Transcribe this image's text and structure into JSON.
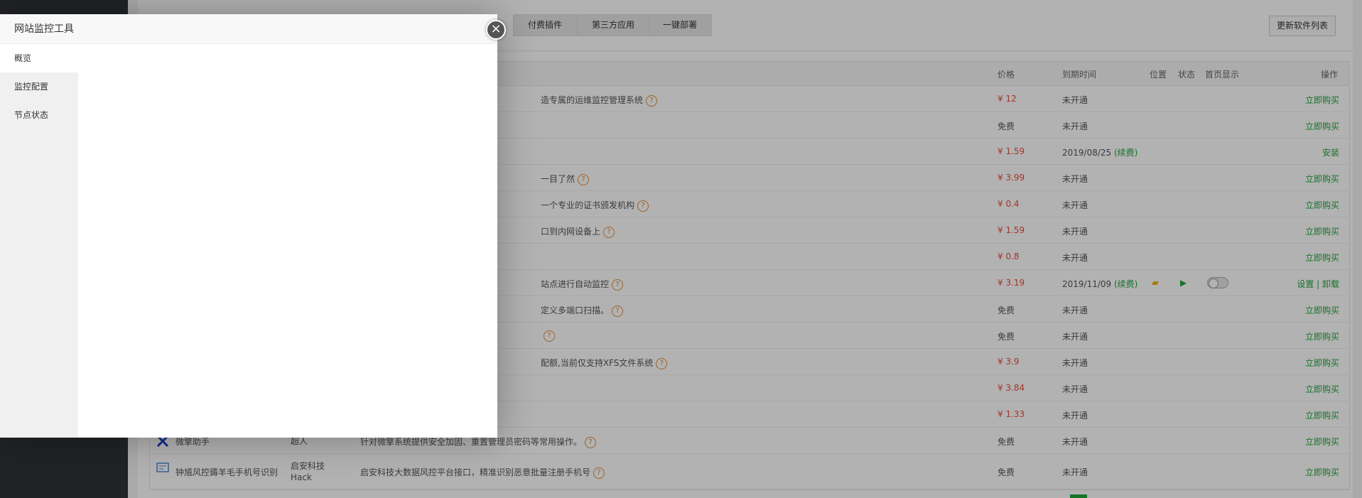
{
  "tabs": [
    "付费插件",
    "第三方应用",
    "一键部署"
  ],
  "update_list_label": "更新软件列表",
  "table": {
    "headers": {
      "price": "价格",
      "expire": "到期时间",
      "position": "位置",
      "status": "状态",
      "home_display": "首页显示",
      "ops": "操作"
    },
    "rows": [
      {
        "desc": "造专属的运维监控管理系统",
        "q": true,
        "price": "¥ 12",
        "price_type": "red",
        "expire": "未开通",
        "renew": "",
        "op": "立即购买"
      },
      {
        "desc": "",
        "q": false,
        "price": "免费",
        "price_type": "free",
        "expire": "未开通",
        "renew": "",
        "op": "立即购买"
      },
      {
        "desc": "",
        "q": false,
        "price": "¥ 1.59",
        "price_type": "red",
        "expire": "2019/08/25",
        "renew": "(续费)",
        "op": "安装"
      },
      {
        "desc": "一目了然",
        "q": true,
        "price": "¥ 3.99",
        "price_type": "red",
        "expire": "未开通",
        "renew": "",
        "op": "立即购买"
      },
      {
        "desc": "一个专业的证书颁发机构",
        "q": true,
        "price": "¥ 0.4",
        "price_type": "red",
        "expire": "未开通",
        "renew": "",
        "op": "立即购买"
      },
      {
        "desc": "口到内网设备上",
        "q": true,
        "price": "¥ 1.59",
        "price_type": "red",
        "expire": "未开通",
        "renew": "",
        "op": "立即购买"
      },
      {
        "desc": "",
        "q": false,
        "price": "¥ 0.8",
        "price_type": "red",
        "expire": "未开通",
        "renew": "",
        "op": "立即购买"
      },
      {
        "desc": "站点进行自动监控",
        "q": true,
        "price": "¥ 3.19",
        "price_type": "red",
        "expire": "2019/11/09",
        "renew": "(续费)",
        "op": "设置 | 卸载",
        "installed": true
      },
      {
        "desc": "定义多端口扫描。",
        "q": true,
        "price": "免费",
        "price_type": "free",
        "expire": "未开通",
        "renew": "",
        "op": "立即购买"
      },
      {
        "desc": "",
        "q": true,
        "price": "免费",
        "price_type": "free",
        "expire": "未开通",
        "renew": "",
        "op": "立即购买"
      },
      {
        "desc": "配额,当前仅支持XFS文件系统",
        "q": true,
        "price": "¥ 3.9",
        "price_type": "red",
        "expire": "未开通",
        "renew": "",
        "op": "立即购买"
      },
      {
        "desc": "",
        "q": false,
        "price": "¥ 3.84",
        "price_type": "red",
        "expire": "未开通",
        "renew": "",
        "op": "立即购买"
      },
      {
        "desc": "",
        "q": false,
        "price": "¥ 1.33",
        "price_type": "red",
        "expire": "未开通",
        "renew": "",
        "op": "立即购买"
      },
      {
        "name": "微擎助手",
        "dev": "超人",
        "desc": "针对微擎系统提供安全加固、重置管理员密码等常用操作。",
        "q": true,
        "price": "免费",
        "price_type": "free",
        "expire": "未开通",
        "renew": "",
        "op": "立即购买"
      },
      {
        "name": "钟馗风控薅羊毛手机号识别",
        "dev": "启安科技 Hack",
        "desc": "启安科技大数据风控平台接口，精准识别恶意批量注册手机号",
        "q": true,
        "price": "免费",
        "price_type": "free",
        "expire": "未开通",
        "renew": "",
        "op": "立即购买"
      }
    ]
  },
  "modal": {
    "title": "网站监控工具",
    "menu": [
      "概览",
      "监控配置",
      "节点状态"
    ],
    "close_icon": "close-icon"
  }
}
